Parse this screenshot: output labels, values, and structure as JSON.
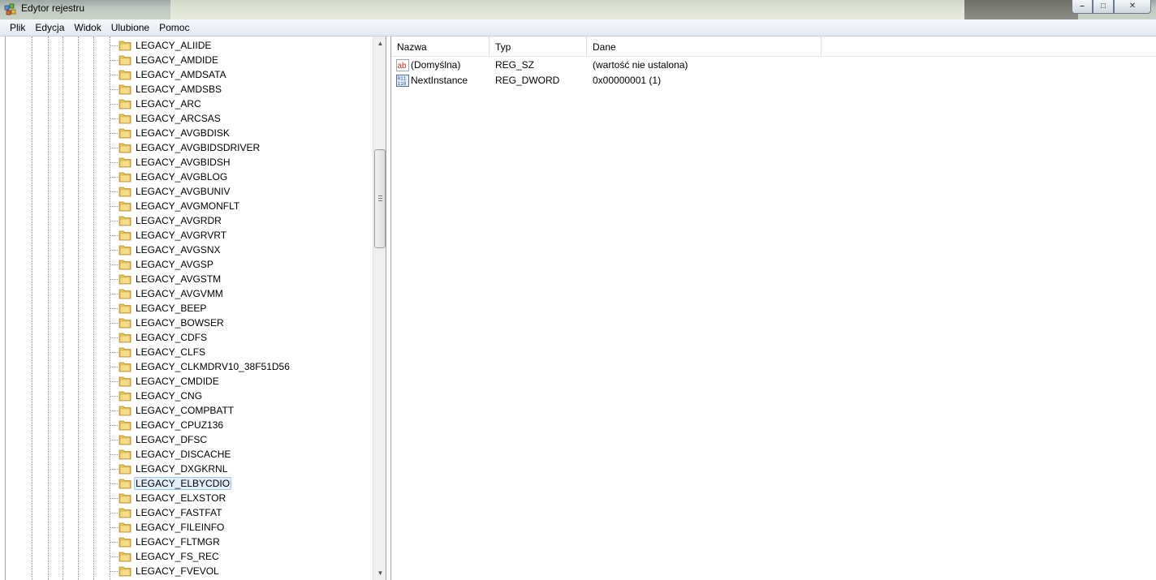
{
  "window": {
    "title": "Edytor rejestru",
    "app_icon": "regedit-icon",
    "buttons": [
      "minimize-icon",
      "maximize-icon",
      "close-icon"
    ]
  },
  "menu": [
    "Plik",
    "Edycja",
    "Widok",
    "Ulubione",
    "Pomoc"
  ],
  "tree": {
    "items": [
      {
        "label": "LEGACY_ALIIDE",
        "expandable": false
      },
      {
        "label": "LEGACY_AMDIDE",
        "expandable": false
      },
      {
        "label": "LEGACY_AMDSATA",
        "expandable": false
      },
      {
        "label": "LEGACY_AMDSBS",
        "expandable": false
      },
      {
        "label": "LEGACY_ARC",
        "expandable": false
      },
      {
        "label": "LEGACY_ARCSAS",
        "expandable": false
      },
      {
        "label": "LEGACY_AVGBDISK",
        "expandable": true
      },
      {
        "label": "LEGACY_AVGBIDSDRIVER",
        "expandable": true
      },
      {
        "label": "LEGACY_AVGBIDSH",
        "expandable": true
      },
      {
        "label": "LEGACY_AVGBLOG",
        "expandable": true
      },
      {
        "label": "LEGACY_AVGBUNIV",
        "expandable": true
      },
      {
        "label": "LEGACY_AVGMONFLT",
        "expandable": true
      },
      {
        "label": "LEGACY_AVGRDR",
        "expandable": true
      },
      {
        "label": "LEGACY_AVGRVRT",
        "expandable": true
      },
      {
        "label": "LEGACY_AVGSNX",
        "expandable": true
      },
      {
        "label": "LEGACY_AVGSP",
        "expandable": true
      },
      {
        "label": "LEGACY_AVGSTM",
        "expandable": true
      },
      {
        "label": "LEGACY_AVGVMM",
        "expandable": true
      },
      {
        "label": "LEGACY_BEEP",
        "expandable": true
      },
      {
        "label": "LEGACY_BOWSER",
        "expandable": true
      },
      {
        "label": "LEGACY_CDFS",
        "expandable": true
      },
      {
        "label": "LEGACY_CLFS",
        "expandable": true
      },
      {
        "label": "LEGACY_CLKMDRV10_38F51D56",
        "expandable": true
      },
      {
        "label": "LEGACY_CMDIDE",
        "expandable": false
      },
      {
        "label": "LEGACY_CNG",
        "expandable": true
      },
      {
        "label": "LEGACY_COMPBATT",
        "expandable": true
      },
      {
        "label": "LEGACY_CPUZ136",
        "expandable": true
      },
      {
        "label": "LEGACY_DFSC",
        "expandable": true
      },
      {
        "label": "LEGACY_DISCACHE",
        "expandable": true
      },
      {
        "label": "LEGACY_DXGKRNL",
        "expandable": true
      },
      {
        "label": "LEGACY_ELBYCDIO",
        "expandable": false,
        "selected": true
      },
      {
        "label": "LEGACY_ELXSTOR",
        "expandable": false
      },
      {
        "label": "LEGACY_FASTFAT",
        "expandable": true
      },
      {
        "label": "LEGACY_FILEINFO",
        "expandable": true
      },
      {
        "label": "LEGACY_FLTMGR",
        "expandable": true
      },
      {
        "label": "LEGACY_FS_REC",
        "expandable": true
      },
      {
        "label": "LEGACY_FVEVOL",
        "expandable": true
      }
    ]
  },
  "list": {
    "columns": [
      "Nazwa",
      "Typ",
      "Dane"
    ],
    "rows": [
      {
        "icon": "string-value-icon",
        "name": "(Domyślna)",
        "type": "REG_SZ",
        "data": "(wartość nie ustalona)"
      },
      {
        "icon": "binary-value-icon",
        "name": "NextInstance",
        "type": "REG_DWORD",
        "data": "0x00000001 (1)"
      }
    ]
  },
  "colors": {
    "selection_bg": "#e2eef9",
    "selection_border": "#9fc6ea",
    "folder": "#e8c55a"
  }
}
